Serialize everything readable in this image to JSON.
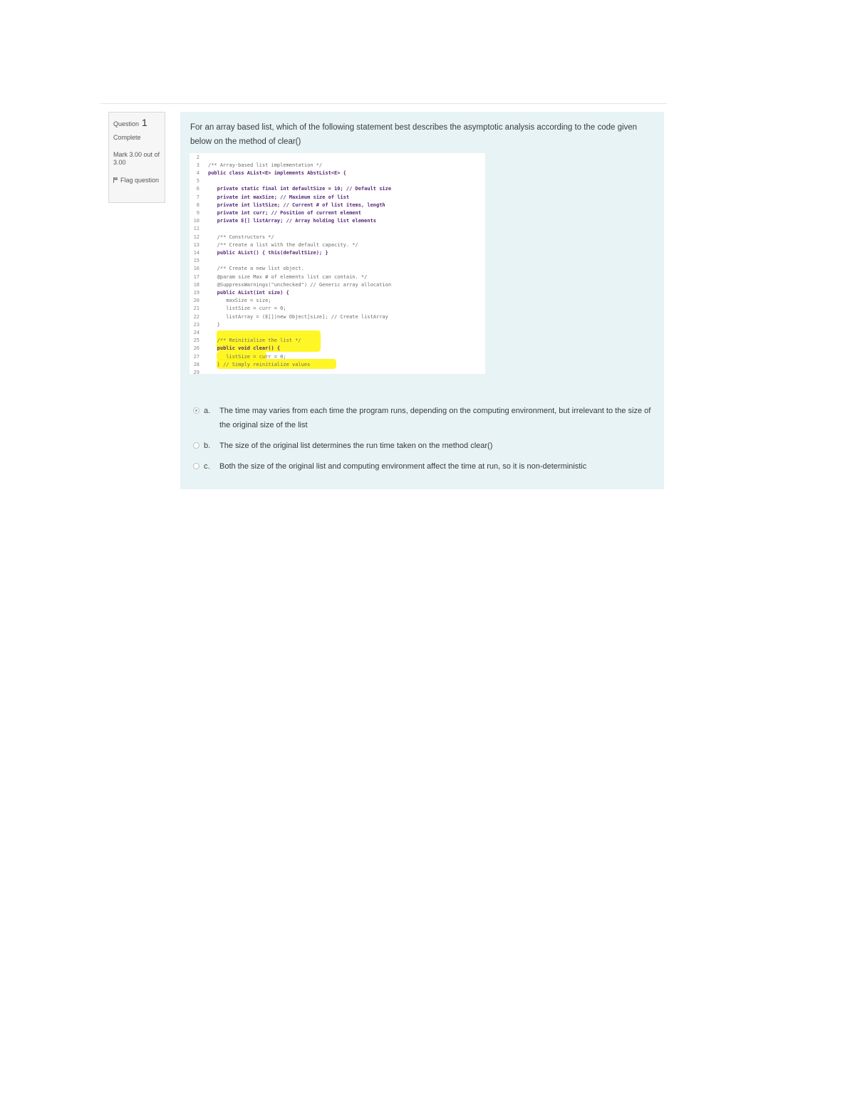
{
  "info": {
    "question_label": "Question",
    "question_number": "1",
    "state": "Complete",
    "grade": "Mark 3.00 out of 3.00",
    "flag_label": "Flag question"
  },
  "question": {
    "text": "For an array based list, which of the following statement best describes the asymptotic analysis according to the code given below on the method of clear()"
  },
  "code": {
    "lines": [
      {
        "n": "2",
        "text": "",
        "kw": false
      },
      {
        "n": "3",
        "text": "/** Array-based list implementation */",
        "kw": false
      },
      {
        "n": "4",
        "text": "public class AList<E> implements AbstList<E> {",
        "kw": true
      },
      {
        "n": "5",
        "text": "",
        "kw": false
      },
      {
        "n": "6",
        "text": "   private static final int defaultSize = 10; // Default size",
        "kw": true
      },
      {
        "n": "7",
        "text": "   private int maxSize; // Maximum size of list",
        "kw": true
      },
      {
        "n": "8",
        "text": "   private int listSize; // Current # of list items, length",
        "kw": true
      },
      {
        "n": "9",
        "text": "   private int curr; // Position of current element",
        "kw": true
      },
      {
        "n": "10",
        "text": "   private E[] listArray; // Array holding list elements",
        "kw": true
      },
      {
        "n": "11",
        "text": "",
        "kw": false
      },
      {
        "n": "12",
        "text": "   /** Constructors */",
        "kw": false
      },
      {
        "n": "13",
        "text": "   /** Create a list with the default capacity. */",
        "kw": false
      },
      {
        "n": "14",
        "text": "   public AList() { this(defaultSize); }",
        "kw": true
      },
      {
        "n": "15",
        "text": "",
        "kw": false
      },
      {
        "n": "16",
        "text": "   /** Create a new list object.",
        "kw": false
      },
      {
        "n": "17",
        "text": "   @param size Max # of elements list can contain. */",
        "kw": false
      },
      {
        "n": "18",
        "text": "   @SuppressWarnings(\"unchecked\") // Generic array allocation",
        "kw": false
      },
      {
        "n": "19",
        "text": "   public AList(int size) {",
        "kw": true
      },
      {
        "n": "20",
        "text": "      maxSize = size;",
        "kw": false
      },
      {
        "n": "21",
        "text": "      listSize = curr = 0;",
        "kw": false
      },
      {
        "n": "22",
        "text": "      listArray = (E[])new Object[size]; // Create listArray",
        "kw": false
      },
      {
        "n": "23",
        "text": "   }",
        "kw": false
      },
      {
        "n": "24",
        "text": "",
        "kw": false
      },
      {
        "n": "25",
        "text": "   /** Reinitialize the list */",
        "kw": false
      },
      {
        "n": "26",
        "text": "   public void clear() {",
        "kw": true
      },
      {
        "n": "27",
        "text": "      listSize = curr = 0;",
        "kw": false
      },
      {
        "n": "28",
        "text": "   } // Simply reinitialize values",
        "kw": false
      },
      {
        "n": "29",
        "text": "",
        "kw": false
      }
    ]
  },
  "options": [
    {
      "letter": "a.",
      "text": "The time may varies from each time the program runs, depending on the computing environment, but irrelevant to the size of the original size of the list",
      "checked": true
    },
    {
      "letter": "b.",
      "text": "The size of the original list determines the run time taken on the method clear()",
      "checked": false
    },
    {
      "letter": "c.",
      "text": "Both the size of the original list and computing environment affect the time at run, so it is non-deterministic",
      "checked": false
    }
  ]
}
